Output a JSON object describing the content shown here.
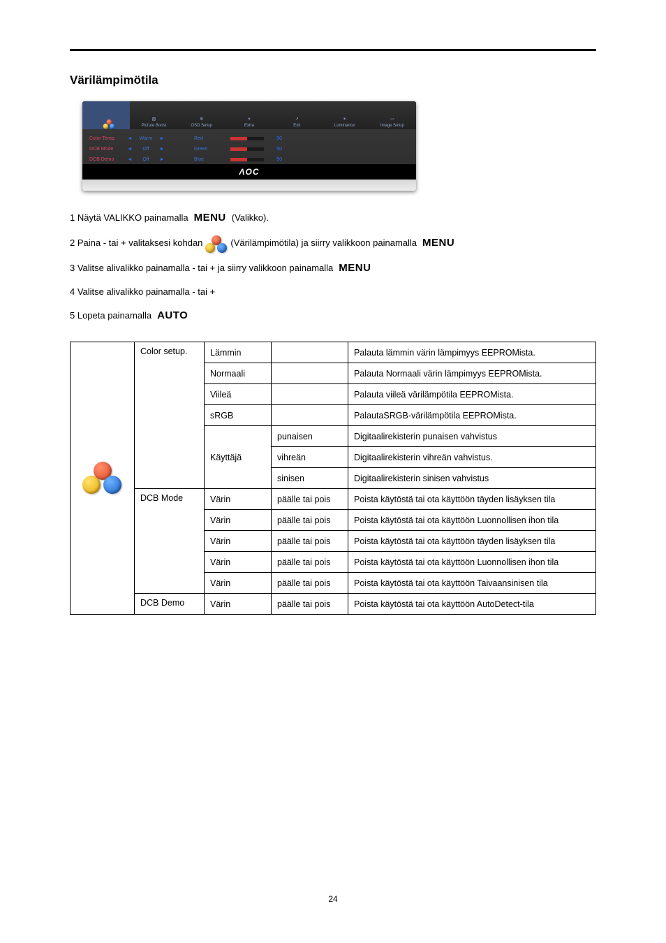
{
  "page_number": "24",
  "heading": "Värilämpimötila",
  "osd": {
    "tabs": [
      "",
      "Picture Boost",
      "OSD Setup",
      "Extra",
      "Exit",
      "Luminance",
      "Image Setup"
    ],
    "rows": [
      {
        "label": "Color Temp.",
        "value": "Warm",
        "color": "Red",
        "num": "50"
      },
      {
        "label": "DCB Mode",
        "value": "Off",
        "color": "Green",
        "num": "50"
      },
      {
        "label": "DCB Demo",
        "value": "Off",
        "color": "Blue",
        "num": "50"
      }
    ],
    "brand": "ΛOC"
  },
  "steps": {
    "s1a": "1 Näytä VALIKKO painamalla",
    "s1b": "(Valikko).",
    "s2a": "2 Paina - tai + valitaksesi kohdan",
    "s2b": "(Värilämpimötila) ja siirry valikkoon painamalla",
    "s3": "3 Valitse alivalikko painamalla - tai + ja siirry valikkoon painamalla",
    "s4": "4 Valitse alivalikko painamalla - tai +",
    "s5": "5 Lopeta painamalla",
    "menu_glyph": "MENU",
    "auto_glyph": "AUTO"
  },
  "table": {
    "group1_hdr": "Color setup.",
    "group2_hdr": "DCB Mode",
    "group3_hdr": "DCB Demo",
    "rows": [
      {
        "b": "Lämmin",
        "c": "",
        "d": "Palauta lämmin värin lämpimyys EEPROMista."
      },
      {
        "b": "Normaali",
        "c": "",
        "d": "Palauta Normaali värin lämpimyys EEPROMista."
      },
      {
        "b": "Viileä",
        "c": "",
        "d": "Palauta viileä värilämpötila EEPROMista."
      },
      {
        "b": "sRGB",
        "c": "",
        "d": "PalautaSRGB-värilämpötila EEPROMista."
      },
      {
        "b": "",
        "c": "punaisen",
        "d": "Digitaalirekisterin punaisen vahvistus"
      },
      {
        "b": "Käyttäjä",
        "c": "vihreän",
        "d": "Digitaalirekisterin vihreän vahvistus."
      },
      {
        "b": "",
        "c": "sinisen",
        "d": "Digitaalirekisterin sinisen vahvistus"
      },
      {
        "b": "Värin",
        "c": "päälle tai pois",
        "d": "Poista käytöstä tai ota käyttöön täyden lisäyksen tila"
      },
      {
        "b": "Värin",
        "c": "päälle tai pois",
        "d": "Poista käytöstä tai ota käyttöön Luonnollisen ihon tila"
      },
      {
        "b": "Värin",
        "c": "päälle tai pois",
        "d": "Poista käytöstä tai ota käyttöön täyden lisäyksen tila"
      },
      {
        "b": "Värin",
        "c": "päälle tai pois",
        "d": "Poista käytöstä tai ota käyttöön Luonnollisen ihon tila"
      },
      {
        "b": "Värin",
        "c": "päälle tai pois",
        "d": "Poista käytöstä tai ota käyttöön Taivaansinisen tila"
      },
      {
        "b": "Värin",
        "c": "päälle tai pois",
        "d": "Poista käytöstä tai ota käyttöön AutoDetect-tila"
      }
    ]
  }
}
